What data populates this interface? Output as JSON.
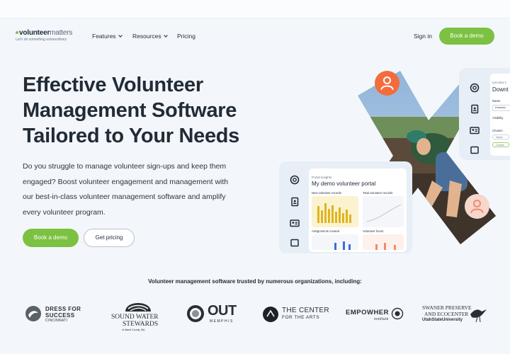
{
  "brand": {
    "name_bold": "volunteer",
    "name_light": "matters",
    "tagline": "Let's do something extraordinary"
  },
  "nav": {
    "items": [
      "Features",
      "Resources",
      "Pricing"
    ],
    "signin": "Sign in",
    "cta": "Book a demo"
  },
  "hero": {
    "title_lines": [
      "Effective Volunteer",
      "Management Software",
      "Tailored to Your Needs"
    ],
    "description_lines": [
      "Do you struggle to manage volunteer sign-ups and keep them",
      "engaged? Boost volunteer engagement and management with",
      "our best-in-class volunteer management software and amplify",
      "every volunteer program."
    ],
    "primary_button": "Book a demo",
    "secondary_button": "Get pricing"
  },
  "mockup_portal": {
    "small_label": "Portal insights",
    "title": "My demo volunteer portal",
    "card1": "New volunteer records",
    "card2": "Total volunteer records",
    "card3": "Assignments created",
    "card4": "Volunteer hours"
  },
  "mockup_list": {
    "label": "List view s",
    "title": "Downt",
    "name_label": "Name",
    "name_value": "Downtow",
    "visibility_label": "Visibility",
    "chosen_label": "Chosen",
    "pill1": "Name",
    "pill2": "Campa"
  },
  "trusted": {
    "heading": "Volunteer management software trusted by numerous organizations, including:",
    "logos": {
      "dress_for_success": [
        "DRESS FOR",
        "SUCCESS",
        "CINCINNATI"
      ],
      "sound_water": [
        "SOUND WATER",
        "STEWARDS",
        "of Island County, WA"
      ],
      "out_memphis": [
        "OUT",
        "MEMPHIS"
      ],
      "center_arts": [
        "THE CENTER",
        "FOR THE ARTS"
      ],
      "empowher": [
        "EMPOWHER",
        "institute"
      ],
      "swaner": [
        "SWANER PRESERVE",
        "AND ECOCENTER",
        "UtahStateUniversity"
      ]
    }
  },
  "colors": {
    "accent_green": "#7cc142",
    "avatar_orange": "#f36c3d",
    "background": "#f3f7fb"
  }
}
